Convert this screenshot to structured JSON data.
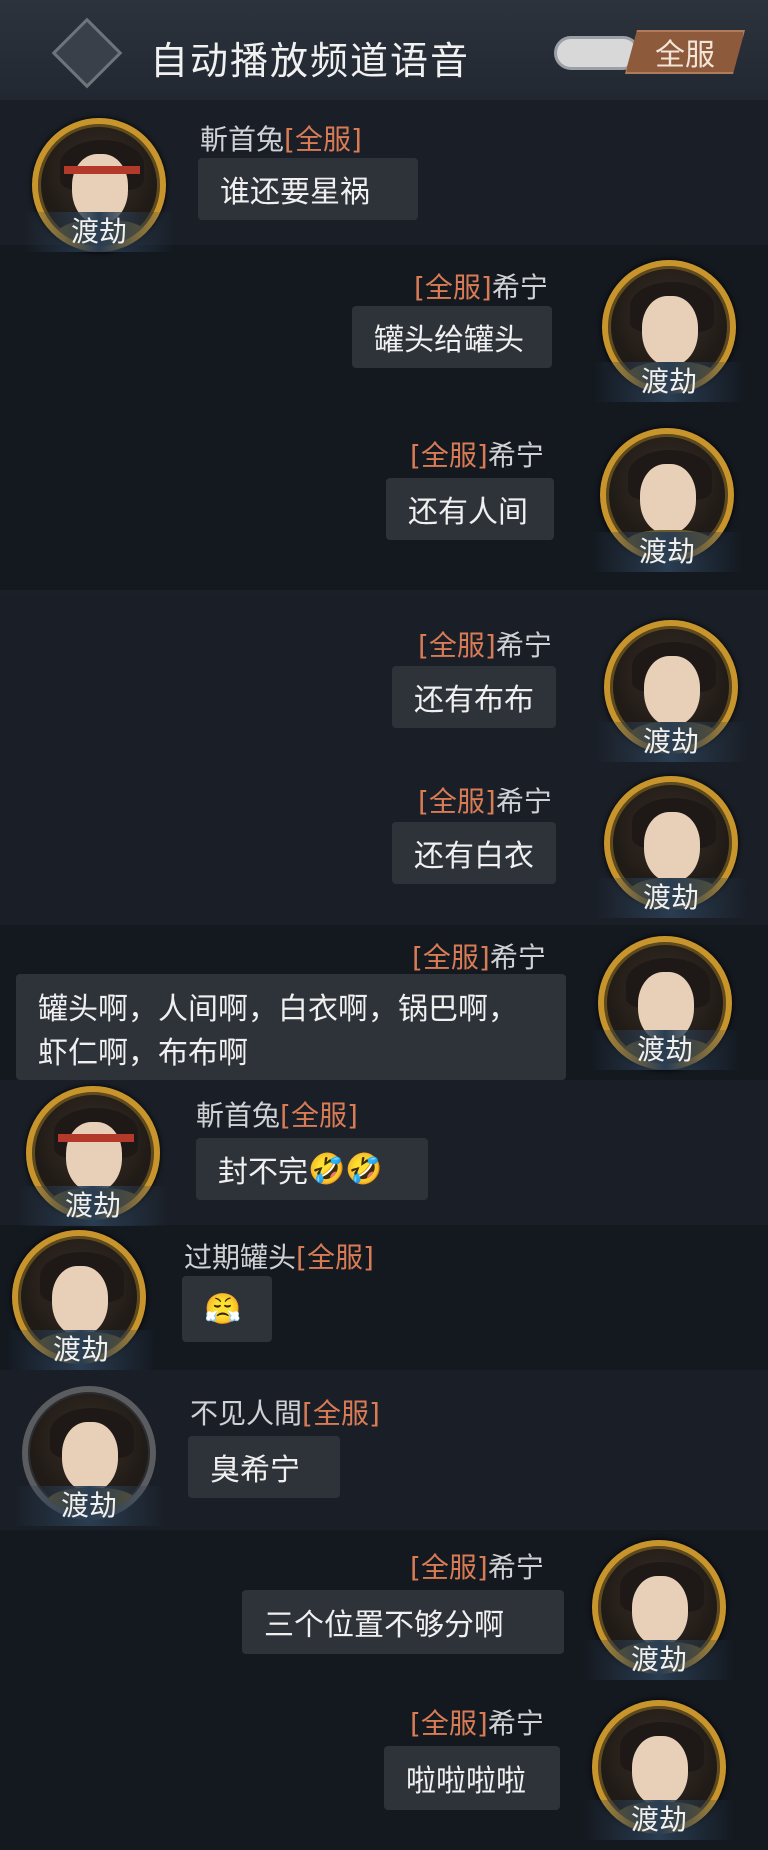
{
  "header": {
    "title": "自动播放频道语音",
    "server_tab": "全服"
  },
  "messages": [
    {
      "sender": "斬首兔",
      "tag": "[全服]",
      "text": "谁还要星祸",
      "badge": "渡劫"
    },
    {
      "sender": "希宁",
      "tag": "[全服]",
      "text": "罐头给罐头",
      "badge": "渡劫"
    },
    {
      "sender": "希宁",
      "tag": "[全服]",
      "text": "还有人间",
      "badge": "渡劫"
    },
    {
      "sender": "希宁",
      "tag": "[全服]",
      "text": "还有布布",
      "badge": "渡劫"
    },
    {
      "sender": "希宁",
      "tag": "[全服]",
      "text": "还有白衣",
      "badge": "渡劫"
    },
    {
      "sender": "希宁",
      "tag": "[全服]",
      "text": "罐头啊，人间啊，白衣啊，锅巴啊，虾仁啊，布布啊",
      "badge": "渡劫"
    },
    {
      "sender": "斬首兔",
      "tag": "[全服]",
      "text": "封不完",
      "emoji": "🤣🤣",
      "badge": "渡劫"
    },
    {
      "sender": "过期罐头",
      "tag": "[全服]",
      "emoji": "😤",
      "badge": "渡劫"
    },
    {
      "sender": "不见人間",
      "tag": "[全服]",
      "text": "臭希宁",
      "badge": "渡劫"
    },
    {
      "sender": "希宁",
      "tag": "[全服]",
      "text": "三个位置不够分啊",
      "badge": "渡劫"
    },
    {
      "sender": "希宁",
      "tag": "[全服]",
      "text": "啦啦啦啦",
      "badge": "渡劫"
    }
  ],
  "colors": {
    "tag": "#d97b55",
    "avatar_ring": "#c8952c"
  }
}
